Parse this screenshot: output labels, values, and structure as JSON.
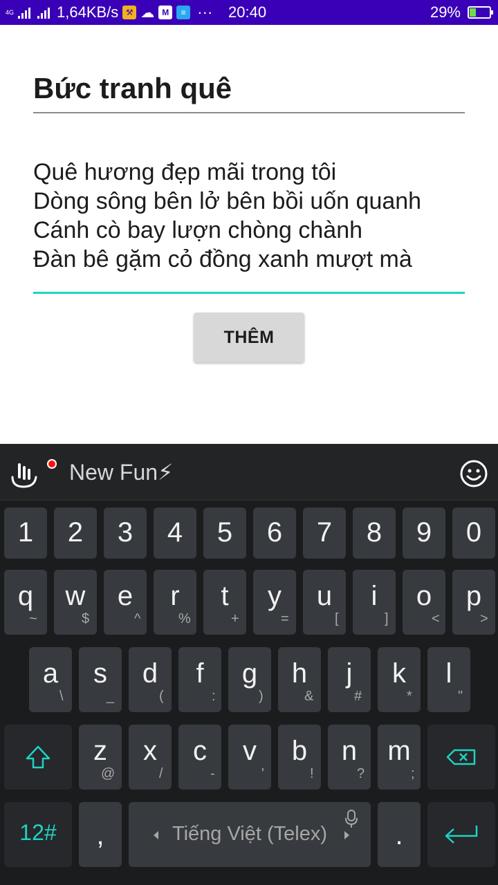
{
  "status_bar": {
    "network": "4G",
    "speed": "1,64KB/s",
    "time": "20:40",
    "battery_percent": "29%",
    "battery_level": 0.29,
    "more": "···"
  },
  "form": {
    "title": "Bức tranh quê",
    "poem_lines": [
      "Quê hương đẹp mãi trong tôi",
      "Dòng sông bên lở bên bồi uốn quanh",
      "Cánh cò bay lượn chòng chành",
      "Đàn bê gặm cỏ đồng xanh mượt mà"
    ],
    "add_button": "THÊM",
    "accent_color": "#1ed3c4"
  },
  "keyboard": {
    "theme_name": "New Fun⚡",
    "row_numbers": [
      "1",
      "2",
      "3",
      "4",
      "5",
      "6",
      "7",
      "8",
      "9",
      "0"
    ],
    "row_q": [
      {
        "main": "q",
        "sub": "~"
      },
      {
        "main": "w",
        "sub": "$"
      },
      {
        "main": "e",
        "sub": "^"
      },
      {
        "main": "r",
        "sub": "%"
      },
      {
        "main": "t",
        "sub": "+"
      },
      {
        "main": "y",
        "sub": "="
      },
      {
        "main": "u",
        "sub": "["
      },
      {
        "main": "i",
        "sub": "]"
      },
      {
        "main": "o",
        "sub": "<"
      },
      {
        "main": "p",
        "sub": ">"
      }
    ],
    "row_a": [
      {
        "main": "a",
        "sub": "\\"
      },
      {
        "main": "s",
        "sub": "_"
      },
      {
        "main": "d",
        "sub": "("
      },
      {
        "main": "f",
        "sub": ":"
      },
      {
        "main": "g",
        "sub": ")"
      },
      {
        "main": "h",
        "sub": "&"
      },
      {
        "main": "j",
        "sub": "#"
      },
      {
        "main": "k",
        "sub": "*"
      },
      {
        "main": "l",
        "sub": "\""
      }
    ],
    "row_z": [
      {
        "main": "z",
        "sub": "@"
      },
      {
        "main": "x",
        "sub": "/"
      },
      {
        "main": "c",
        "sub": "-"
      },
      {
        "main": "v",
        "sub": "'"
      },
      {
        "main": "b",
        "sub": "!"
      },
      {
        "main": "n",
        "sub": "?"
      },
      {
        "main": "m",
        "sub": ";"
      }
    ],
    "symbols_key": "12#",
    "comma_key": ",",
    "space_label": "Tiếng Việt (Telex)",
    "period_key": "."
  }
}
